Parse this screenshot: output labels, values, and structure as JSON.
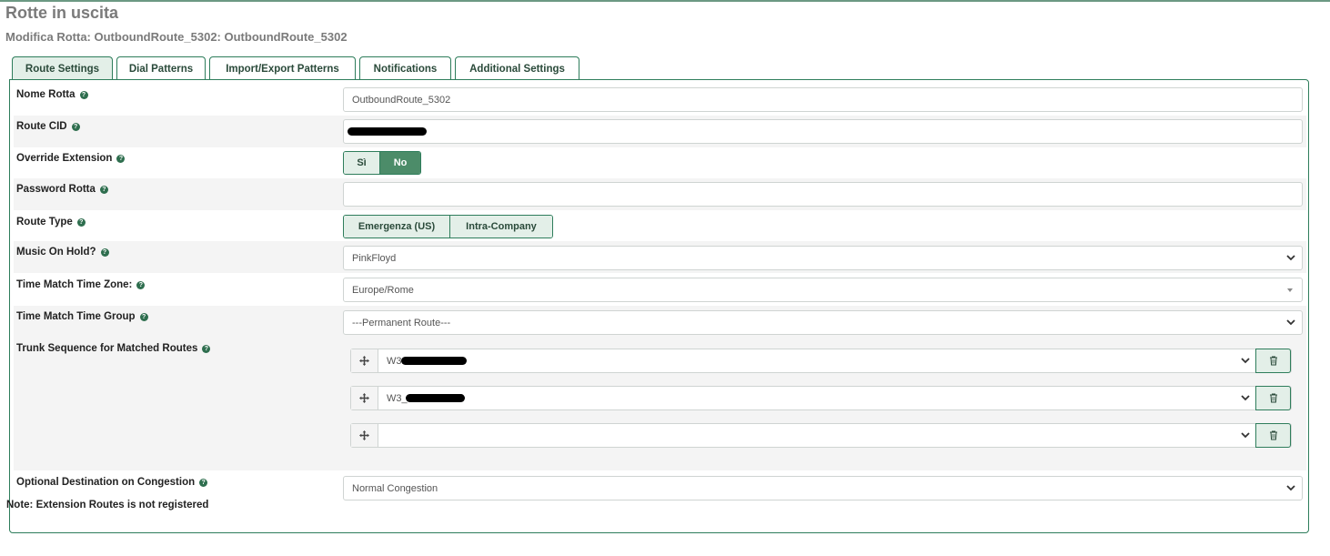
{
  "header": {
    "title": "Rotte in uscita",
    "subtitle": "Modifica Rotta: OutboundRoute_5302: OutboundRoute_5302"
  },
  "tabs": [
    {
      "label": "Route Settings",
      "active": true
    },
    {
      "label": "Dial Patterns"
    },
    {
      "label": "Import/Export Patterns"
    },
    {
      "label": "Notifications"
    },
    {
      "label": "Additional Settings"
    }
  ],
  "form": {
    "route_name": {
      "label": "Nome Rotta",
      "value": "OutboundRoute_5302"
    },
    "route_cid": {
      "label": "Route CID",
      "value": ""
    },
    "override_extension": {
      "label": "Override Extension",
      "options": [
        "Sì",
        "No"
      ],
      "selected": "No"
    },
    "route_password": {
      "label": "Password Rotta",
      "value": ""
    },
    "route_type": {
      "label": "Route Type",
      "options": [
        "Emergenza (US)",
        "Intra-Company"
      ]
    },
    "music_on_hold": {
      "label": "Music On Hold?",
      "value": "PinkFloyd"
    },
    "time_zone": {
      "label": "Time Match Time Zone:",
      "value": "Europe/Rome"
    },
    "time_group": {
      "label": "Time Match Time Group",
      "value": "---Permanent Route---"
    },
    "trunk_sequence": {
      "label": "Trunk Sequence for Matched Routes",
      "trunks": [
        {
          "value": "W3"
        },
        {
          "value": "W3_"
        },
        {
          "value": ""
        }
      ]
    },
    "congestion": {
      "label": "Optional Destination on Congestion",
      "value": "Normal Congestion"
    }
  },
  "note": "Note: Extension Routes is not registered",
  "colors": {
    "accent": "#2e7d5b",
    "accent_fill": "#4c8c69",
    "tab_active": "#e3efe8",
    "row_shade": "#f4f4f4"
  },
  "icons": {
    "help": "help-circle-icon",
    "move": "move-arrows-icon",
    "delete": "trash-icon",
    "dropdown": "chevron-down-icon"
  }
}
